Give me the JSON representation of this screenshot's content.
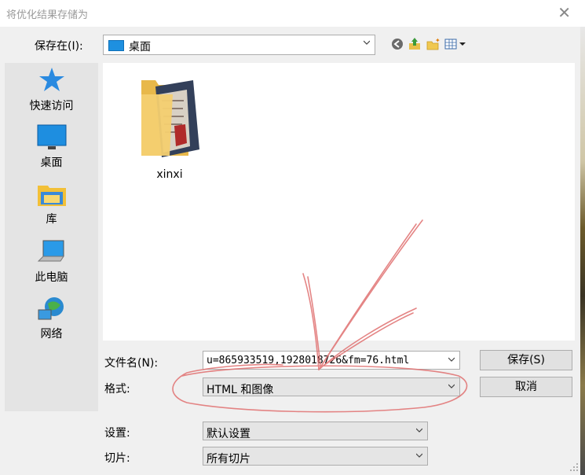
{
  "window": {
    "title": "将优化结果存储为"
  },
  "savein": {
    "label": "保存在(I):",
    "value": "桌面"
  },
  "places": [
    {
      "label": "快速访问",
      "icon": "star-icon"
    },
    {
      "label": "桌面",
      "icon": "desktop-icon"
    },
    {
      "label": "库",
      "icon": "library-icon"
    },
    {
      "label": "此电脑",
      "icon": "computer-icon"
    },
    {
      "label": "网络",
      "icon": "network-icon"
    }
  ],
  "files": [
    {
      "name": "xinxi",
      "icon": "folder-icon"
    }
  ],
  "filename": {
    "label": "文件名(N):",
    "value": "u=865933519,1928018726&fm=76.html"
  },
  "format": {
    "label": "格式:",
    "value": "HTML 和图像"
  },
  "settings": {
    "label": "设置:",
    "value": "默认设置"
  },
  "slices": {
    "label": "切片:",
    "value": "所有切片"
  },
  "buttons": {
    "save": "保存(S)",
    "cancel": "取消"
  },
  "colors": {
    "annotation": "#e07070",
    "accent": "#1e90e0"
  }
}
